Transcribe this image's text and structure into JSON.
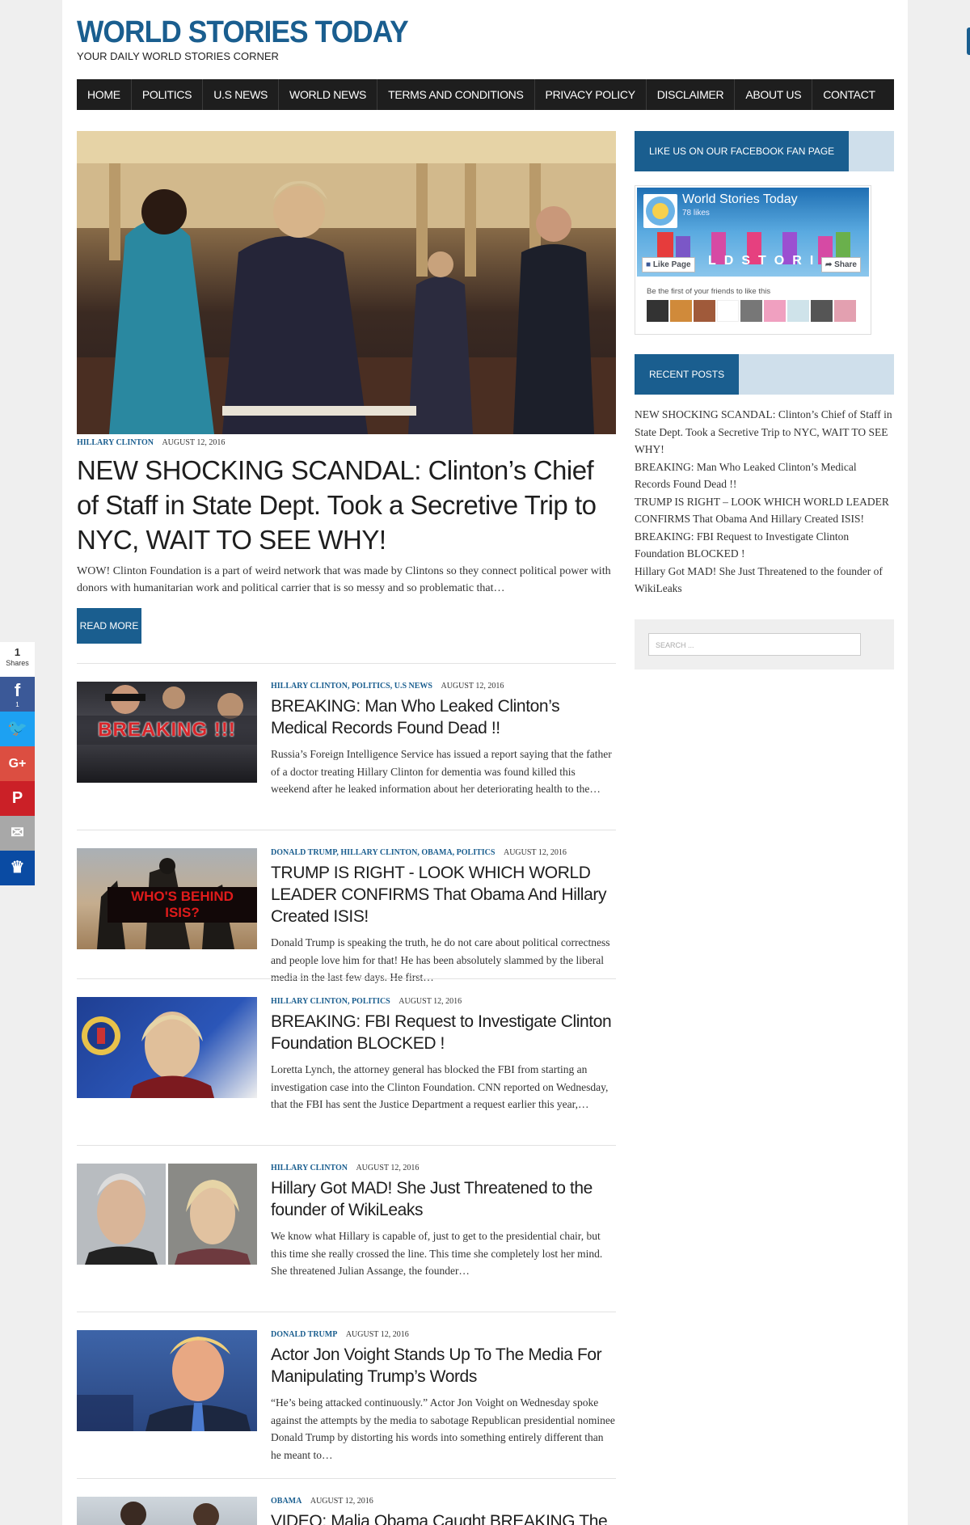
{
  "site": {
    "title": "WORLD STORIES TODAY",
    "tagline": "YOUR DAILY WORLD STORIES CORNER"
  },
  "nav": [
    "HOME",
    "POLITICS",
    "U.S NEWS",
    "WORLD NEWS",
    "TERMS AND CONDITIONS",
    "PRIVACY POLICY",
    "DISCLAIMER",
    "ABOUT US",
    "CONTACT"
  ],
  "featured": {
    "category": "HILLARY CLINTON",
    "date": "AUGUST 12, 2016",
    "title": "NEW SHOCKING SCANDAL: Clinton’s Chief of Staff in State Dept. Took a Secretive Trip to NYC, WAIT TO SEE WHY!",
    "excerpt": "WOW! Clinton Foundation is a part of weird network that was made by Clintons so they connect political power with donors with humanitarian work and political carrier that is so messy and so problematic that…",
    "read_more": "READ MORE"
  },
  "posts": [
    {
      "categories": "HILLARY CLINTON, POLITICS, U.S NEWS",
      "date": "AUGUST 12, 2016",
      "title": "BREAKING: Man Who Leaked Clinton’s Medical Records Found Dead !!",
      "excerpt": "Russia’s Foreign Intelligence Service has issued a report saying that the father of a doctor treating Hillary Clinton for dementia was found killed this weekend after he leaked information about her deteriorating health to the…",
      "thumb_text": "BREAKING !!!"
    },
    {
      "categories": "DONALD TRUMP, HILLARY CLINTON, OBAMA, POLITICS",
      "date": "AUGUST 12, 2016",
      "title": "TRUMP IS RIGHT - LOOK WHICH WORLD LEADER CONFIRMS That Obama And Hillary Created ISIS!",
      "excerpt": "Donald Trump is speaking the truth, he do not care about political correctness and people love him for that! He has been absolutely slammed by the liberal media in the last few days. He first…",
      "thumb_text": "WHO'S BEHIND ISIS?"
    },
    {
      "categories": "HILLARY CLINTON, POLITICS",
      "date": "AUGUST 12, 2016",
      "title": "BREAKING: FBI Request to Investigate Clinton Foundation BLOCKED !",
      "excerpt": "Loretta Lynch, the attorney general has blocked the FBI from starting an investigation case into the Clinton Foundation.  CNN reported on Wednesday, that the FBI has sent the Justice Department a request earlier this year,…",
      "thumb_text": ""
    },
    {
      "categories": "HILLARY CLINTON",
      "date": "AUGUST 12, 2016",
      "title": "Hillary Got MAD! She Just Threatened to the founder of WikiLeaks",
      "excerpt": "We know what Hillary is capable of, just to get to the presidential chair, but this time she really crossed the line. This time she completely lost her mind. She threatened Julian Assange, the founder…",
      "thumb_text": ""
    },
    {
      "categories": "DONALD TRUMP",
      "date": "AUGUST 12, 2016",
      "title": "Actor Jon Voight Stands Up To The Media For Manipulating Trump’s Words",
      "excerpt": "“He’s being attacked continuously.” Actor Jon Voight on  Wednesday spoke against the attempts by the media to sabotage Republican presidential nominee Donald Trump by distorting his words into something entirely different than he meant to…",
      "thumb_text": ""
    },
    {
      "categories": "OBAMA",
      "date": "AUGUST 12, 2016",
      "title": "VIDEO: Malia Obama Caught BREAKING The Law",
      "excerpt": "",
      "thumb_text": ""
    }
  ],
  "sidebar": {
    "facebook_heading": "LIKE US ON OUR FACEBOOK FAN PAGE",
    "fb_page_name": "World Stories Today",
    "fb_likes": "78 likes",
    "fb_like_button": "Like Page",
    "fb_share_button": "Share",
    "fb_friends_text": "Be the first of your friends to like this",
    "fb_cover_letters": [
      "L",
      "D",
      "S",
      "T",
      "O",
      "R",
      "I"
    ],
    "recent_heading": "RECENT POSTS",
    "recent_posts": [
      "NEW SHOCKING SCANDAL: Clinton’s Chief of Staff in State Dept. Took a Secretive Trip to NYC, WAIT TO SEE WHY!",
      "BREAKING: Man Who Leaked Clinton’s Medical Records Found Dead !!",
      "TRUMP IS RIGHT – LOOK WHICH WORLD LEADER CONFIRMS That Obama And Hillary Created ISIS!",
      "BREAKING: FBI Request to Investigate Clinton Foundation BLOCKED !",
      "Hillary Got MAD! She Just Threatened to the founder of WikiLeaks"
    ],
    "search_placeholder": "SEARCH ..."
  },
  "share_bar": {
    "count": "1",
    "count_label": "Shares",
    "buttons": [
      {
        "name": "facebook",
        "glyph": "f",
        "color": "#3b5998",
        "count": "1"
      },
      {
        "name": "twitter",
        "glyph": "🐦",
        "color": "#1da1f2",
        "count": ""
      },
      {
        "name": "google-plus",
        "glyph": "G+",
        "color": "#dc4e41",
        "count": ""
      },
      {
        "name": "pinterest",
        "glyph": "P",
        "color": "#cb2027",
        "count": ""
      },
      {
        "name": "email",
        "glyph": "✉",
        "color": "#a8a8a8",
        "count": ""
      },
      {
        "name": "sumome",
        "glyph": "♛",
        "color": "#0a4ba3",
        "count": ""
      }
    ]
  },
  "colors": {
    "brand": "#1a5e8f",
    "nav_bg": "#1e1e1e",
    "widget_head_bg": "#cfdfeb"
  }
}
